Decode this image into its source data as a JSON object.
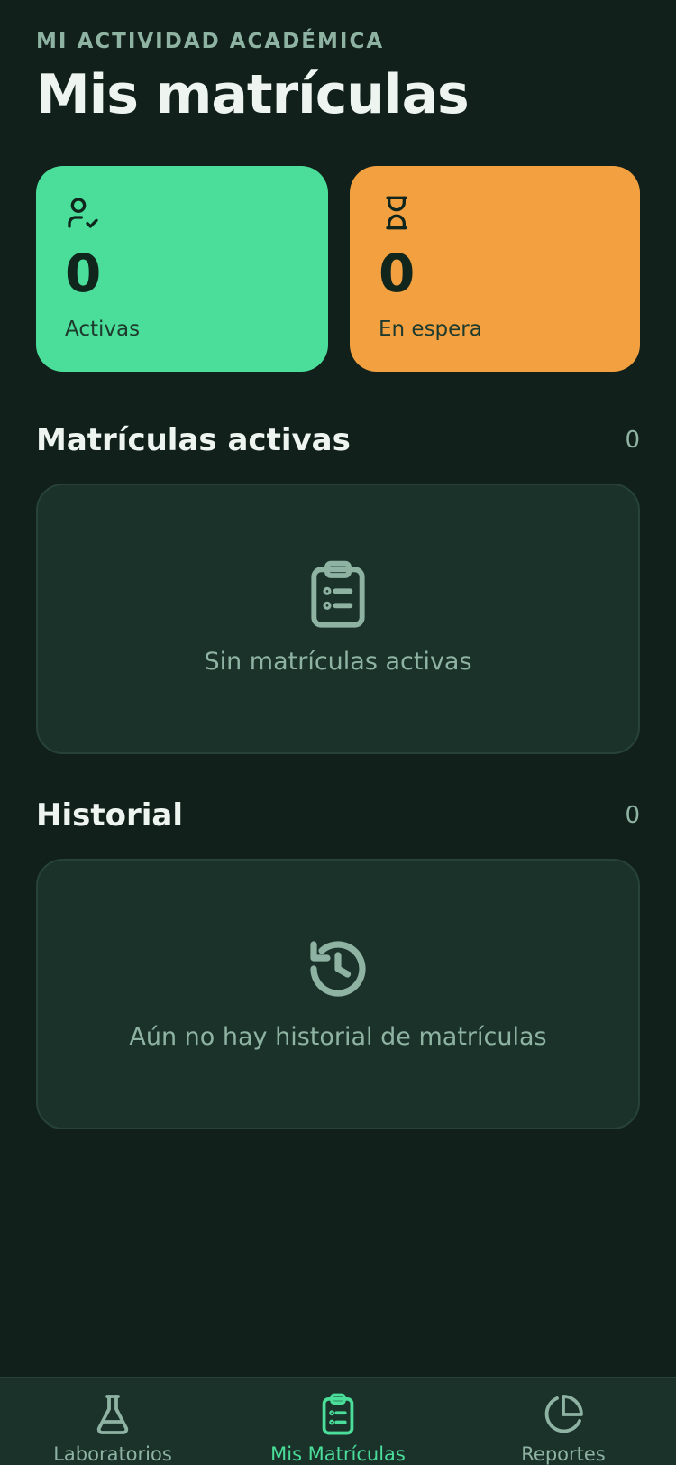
{
  "header": {
    "eyebrow": "MI ACTIVIDAD ACADÉMICA",
    "title": "Mis matrículas"
  },
  "stats": {
    "active": {
      "value": "0",
      "label": "Activas",
      "icon": "user-check-icon",
      "color": "#4ade9a"
    },
    "waiting": {
      "value": "0",
      "label": "En espera",
      "icon": "hourglass-icon",
      "color": "#f2a040"
    }
  },
  "sections": {
    "active": {
      "title": "Matrículas activas",
      "count": "0",
      "empty_message": "Sin matrículas activas",
      "icon": "clipboard-list-icon"
    },
    "history": {
      "title": "Historial",
      "count": "0",
      "empty_message": "Aún no hay historial de matrículas",
      "icon": "history-icon"
    }
  },
  "nav": {
    "items": [
      {
        "label": "Laboratorios",
        "icon": "flask-icon",
        "selected": false
      },
      {
        "label": "Mis Matrículas",
        "icon": "clipboard-list-icon",
        "selected": true
      },
      {
        "label": "Reportes",
        "icon": "pie-chart-icon",
        "selected": false
      }
    ]
  },
  "colors": {
    "background": "#11201b",
    "card": "#1a322a",
    "accent": "#4ade9a",
    "warning": "#f2a040",
    "muted_text": "#8fb3a3"
  }
}
